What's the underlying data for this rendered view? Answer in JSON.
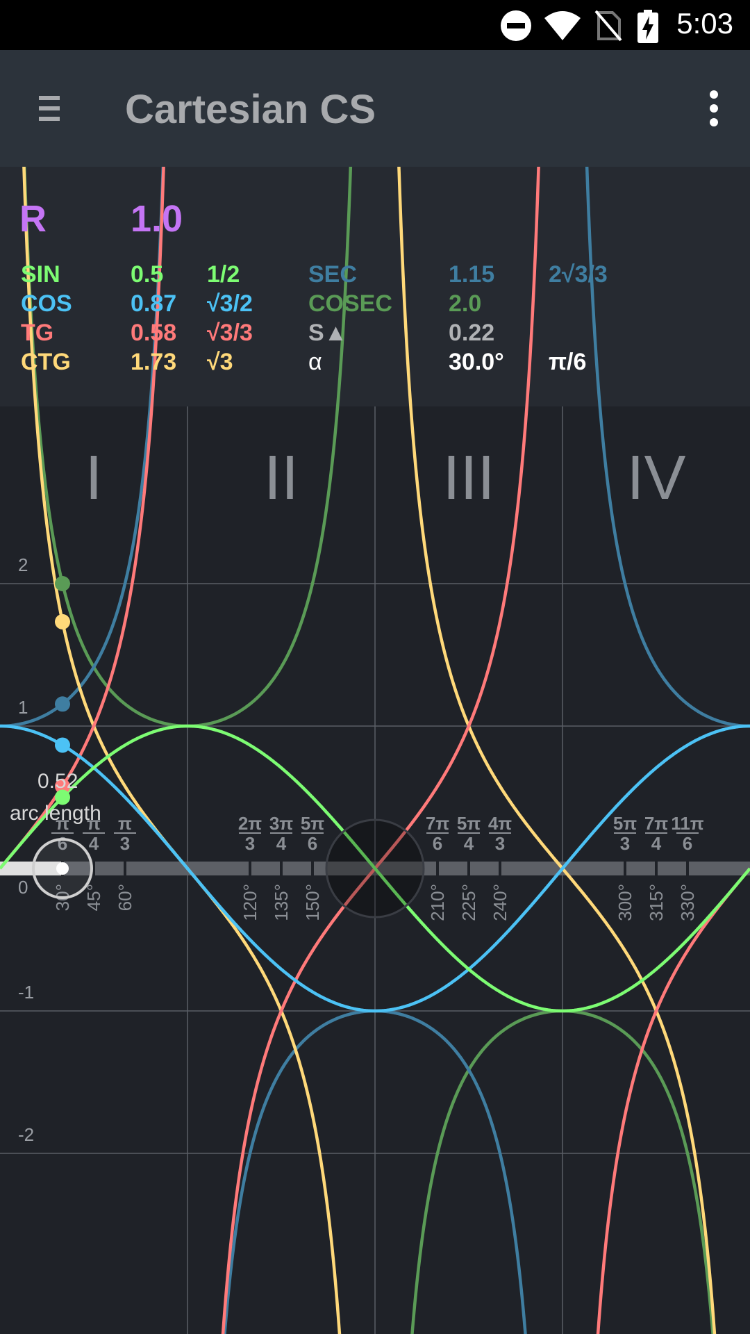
{
  "status_bar": {
    "time": "5:03",
    "icons": [
      "do-not-disturb-icon",
      "wifi-icon",
      "no-sim-icon",
      "battery-charging-icon"
    ]
  },
  "app_bar": {
    "title": "Cartesian CS",
    "menu_icon": "hamburger-menu-icon",
    "more_icon": "overflow-menu-icon"
  },
  "colors": {
    "sin": "#7dfc73",
    "cos": "#4cc2f5",
    "tg": "#ff7a7a",
    "ctg": "#ffd97a",
    "sec": "#3f7ea1",
    "cosec": "#5a9b56",
    "radius": "#c575f5",
    "gray": "#b0b2b5"
  },
  "info": {
    "radius_label": "R",
    "radius_value": "1.0",
    "sin": {
      "label": "SIN",
      "value": "0.5",
      "exact": "1/2"
    },
    "cos": {
      "label": "COS",
      "value": "0.87",
      "exact": "√3/2"
    },
    "tg": {
      "label": "TG",
      "value": "0.58",
      "exact": "√3/3"
    },
    "ctg": {
      "label": "CTG",
      "value": "1.73",
      "exact": "√3"
    },
    "sec": {
      "label": "SEC",
      "value": "1.15",
      "exact": "2√3/3"
    },
    "cosec": {
      "label": "COSEC",
      "value": "2.0"
    },
    "area": {
      "label": "S▲",
      "value": "0.22"
    },
    "alpha": {
      "label": "α",
      "value": "30.0°",
      "exact": "π/6"
    }
  },
  "graph": {
    "quadrants": [
      "I",
      "II",
      "III",
      "IV"
    ],
    "y_ticks": [
      "2",
      "1",
      "0",
      "-1",
      "-2"
    ],
    "angle_degrees": [
      30,
      45,
      60,
      120,
      135,
      150,
      210,
      225,
      240,
      300,
      315,
      330
    ],
    "angle_fractions": [
      {
        "num": "π",
        "den": "6"
      },
      {
        "num": "π",
        "den": "4"
      },
      {
        "num": "π",
        "den": "3"
      },
      {
        "num": "2π",
        "den": "3"
      },
      {
        "num": "3π",
        "den": "4"
      },
      {
        "num": "5π",
        "den": "6"
      },
      {
        "num": "7π",
        "den": "6"
      },
      {
        "num": "5π",
        "den": "4"
      },
      {
        "num": "4π",
        "den": "3"
      },
      {
        "num": "5π",
        "den": "3"
      },
      {
        "num": "7π",
        "den": "4"
      },
      {
        "num": "11π",
        "den": "6"
      }
    ],
    "arc_length_value": "0.52",
    "arc_length_label": "arc length",
    "current_angle_deg": 30
  }
}
